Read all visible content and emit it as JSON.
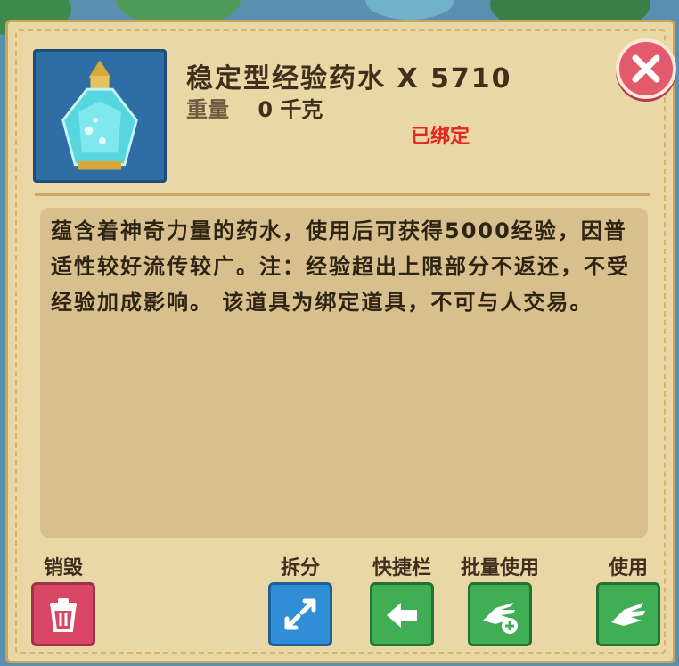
{
  "item": {
    "name": "稳定型经验药水",
    "quantity": "X 5710",
    "weight_label": "重量",
    "weight_value": "0 千克",
    "bound_status": "已绑定",
    "icon": "potion-bottle-icon"
  },
  "description": "蕴含着神奇力量的药水，使用后可获得5000经验，因普适性较好流传较广。注：经验超出上限部分不返还，不受经验加成影响。 该道具为绑定道具，不可与人交易。",
  "actions": {
    "destroy": {
      "label": "销毁",
      "icon": "trash-icon"
    },
    "split": {
      "label": "拆分",
      "icon": "split-arrows-icon"
    },
    "quickbar": {
      "label": "快捷栏",
      "icon": "hand-arrow-icon"
    },
    "batch_use": {
      "label": "批量使用",
      "icon": "hand-plus-icon"
    },
    "use": {
      "label": "使用",
      "icon": "hand-icon"
    }
  },
  "close": {
    "icon": "close-icon"
  },
  "colors": {
    "panel": "#ead7a6",
    "bound_red": "#e32822",
    "close_button": "#e35a6c",
    "destroy_button": "#d94764",
    "split_button": "#2f8ed6",
    "use_button": "#3fae54"
  }
}
